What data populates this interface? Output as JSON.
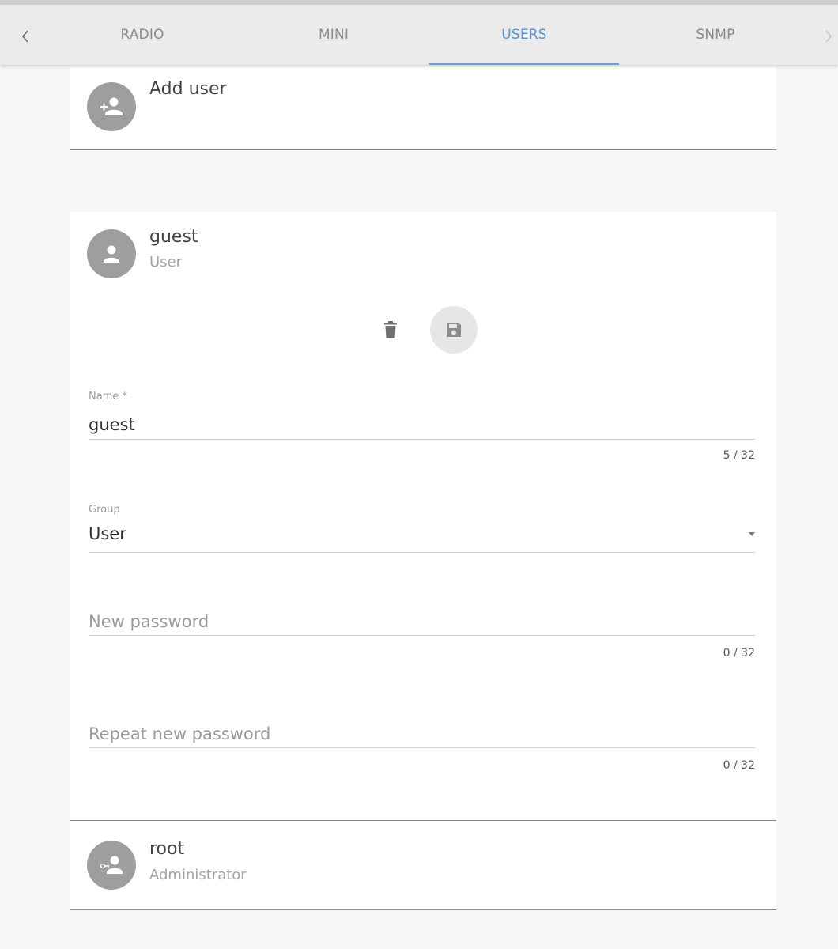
{
  "tabs": {
    "items": [
      {
        "label": "RADIO",
        "active": false
      },
      {
        "label": "MINI",
        "active": false
      },
      {
        "label": "USERS",
        "active": true
      },
      {
        "label": "SNMP",
        "active": false
      }
    ],
    "prev_icon": "chevron-left-icon",
    "next_icon": "chevron-right-icon"
  },
  "add_user": {
    "title": "Add user",
    "icon": "add-user-icon"
  },
  "guest": {
    "name": "guest",
    "group": "User",
    "icon": "user-icon",
    "actions": {
      "delete_icon": "trash-icon",
      "save_icon": "save-icon"
    },
    "form": {
      "name_label": "Name *",
      "name_value": "guest",
      "name_counter": "5 / 32",
      "group_label": "Group",
      "group_value": "User",
      "new_password_placeholder": "New password",
      "new_password_counter": "0 / 32",
      "repeat_password_placeholder": "Repeat new password",
      "repeat_password_counter": "0 / 32"
    }
  },
  "root": {
    "name": "root",
    "group": "Administrator",
    "icon": "admin-key-icon"
  },
  "colors": {
    "accent": "#5b93d3",
    "avatar": "#9e9e9e",
    "tabbar": "#ebebeb",
    "background": "#f6f6f6"
  }
}
